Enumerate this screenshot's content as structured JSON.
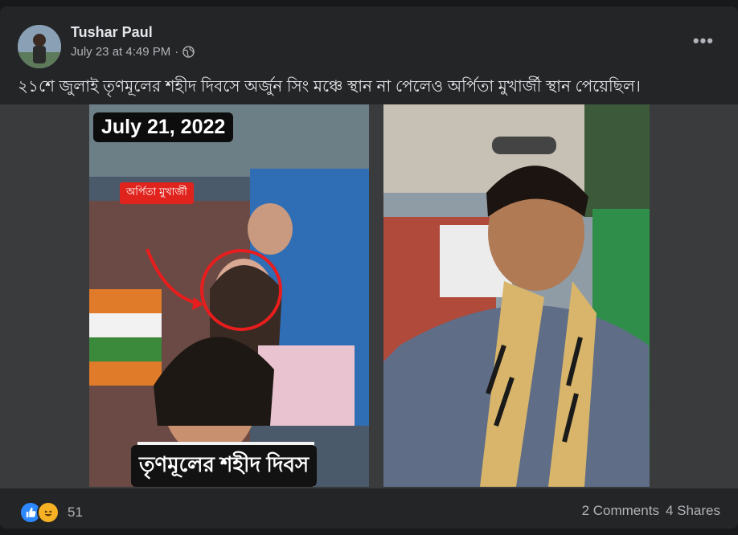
{
  "post": {
    "author": "Tushar Paul",
    "timestamp": "July 23 at 4:49 PM",
    "separator": "·",
    "privacy_icon": "globe-icon",
    "more_label": "•••",
    "caption": "২১শে জুলাই তৃণমূলের শহীদ দিবসে অর্জুন সিং মঞ্চে স্থান না পেলেও অর্পিতা মুখার্জী স্থান পেয়েছিল।"
  },
  "media": {
    "left_photo": {
      "date_overlay": "July 21, 2022",
      "name_tag": "অর্পিতা মুখার্জী",
      "bottom_overlay": "তৃণমূলের শহীদ দিবস"
    }
  },
  "footer": {
    "reaction_icons": [
      "like-icon",
      "haha-icon"
    ],
    "reaction_count": "51",
    "comments": "2 Comments",
    "shares": "4 Shares"
  },
  "colors": {
    "background": "#18191a",
    "card": "#242526",
    "text_primary": "#e4e6eb",
    "text_secondary": "#b0b3b8",
    "like_blue": "#2d88ff",
    "haha_yellow": "#f7b125",
    "tag_red": "#e0241d"
  }
}
